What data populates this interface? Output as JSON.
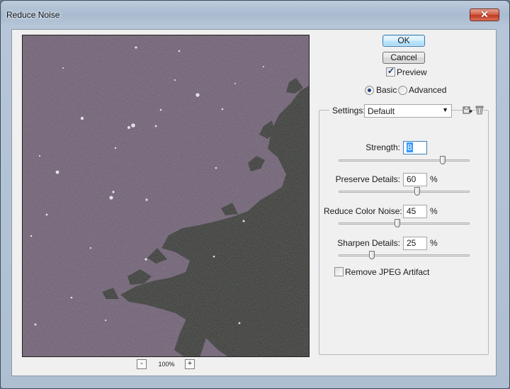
{
  "window": {
    "title": "Reduce Noise"
  },
  "buttons": {
    "ok": "OK",
    "cancel": "Cancel"
  },
  "preview": {
    "label": "Preview",
    "checked": true
  },
  "mode": {
    "basic": "Basic",
    "advanced": "Advanced",
    "selected": "basic"
  },
  "settings": {
    "label": "Settings:",
    "value": "Default"
  },
  "sliders": [
    {
      "label": "Strength:",
      "value": "8",
      "unit": "",
      "fraction": 0.8
    },
    {
      "label": "Preserve Details:",
      "value": "60",
      "unit": "%",
      "fraction": 0.6
    },
    {
      "label": "Reduce Color Noise:",
      "value": "45",
      "unit": "%",
      "fraction": 0.45
    },
    {
      "label": "Sharpen Details:",
      "value": "25",
      "unit": "%",
      "fraction": 0.25
    }
  ],
  "remove_jpeg": {
    "label": "Remove JPEG Artifact",
    "checked": false
  },
  "zoom": {
    "minus": "-",
    "value": "100%",
    "plus": "+"
  },
  "icons": {
    "close": "close-icon",
    "save": "save-settings-icon",
    "delete": "trash-icon"
  },
  "colors": {
    "sky": "#57465e",
    "tree": "#1f221c",
    "default_button": "#3c7fb1",
    "close": "#c23a20"
  }
}
